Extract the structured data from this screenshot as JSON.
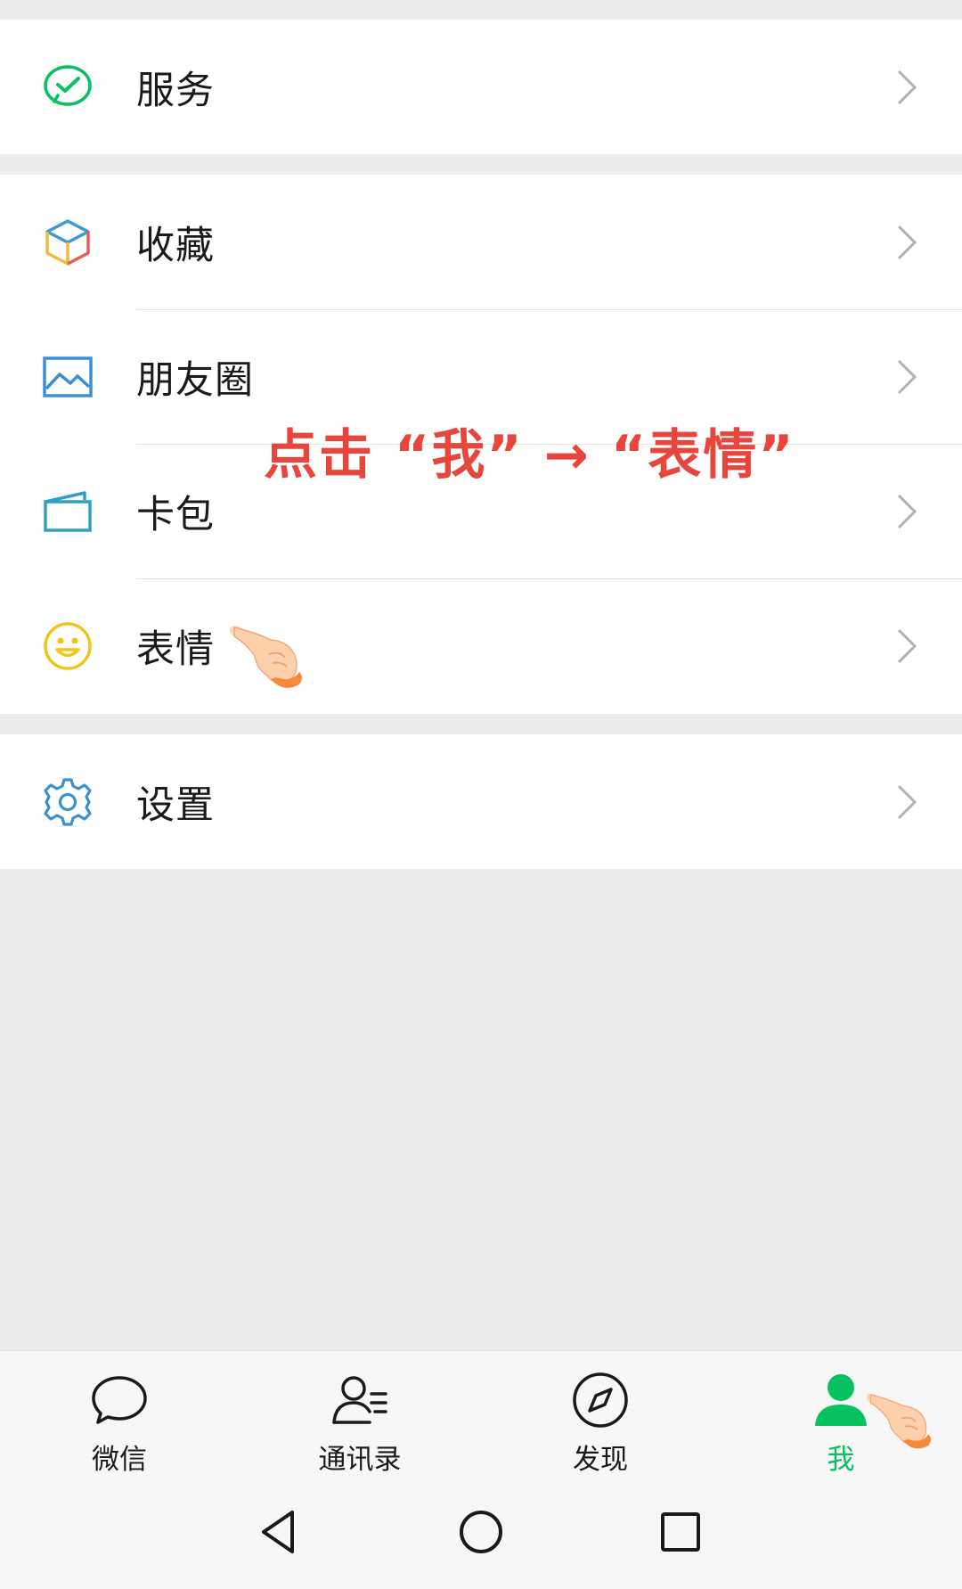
{
  "menu": {
    "service": "服务",
    "favorites": "收藏",
    "moments": "朋友圈",
    "cards": "卡包",
    "stickers": "表情",
    "settings": "设置"
  },
  "annotation": "点击 “我” → “表情”",
  "tabs": {
    "chats": "微信",
    "contacts": "通讯录",
    "discover": "发现",
    "me": "我"
  },
  "colors": {
    "accent": "#07c160",
    "annotation": "#e8453c",
    "background": "#ededed"
  }
}
